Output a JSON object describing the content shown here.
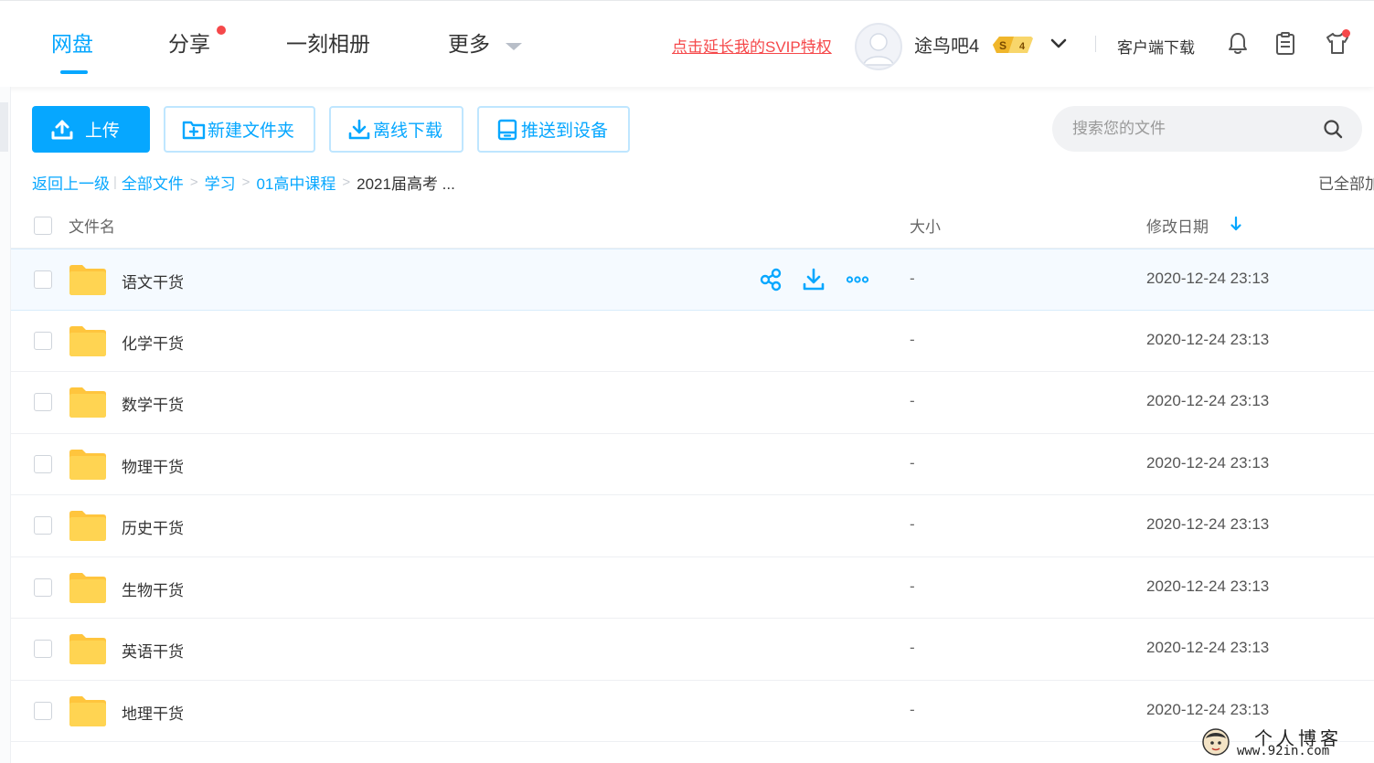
{
  "nav": {
    "tabs": [
      {
        "label": "网盘",
        "active": true
      },
      {
        "label": "分享",
        "has_dot": true
      },
      {
        "label": "一刻相册"
      },
      {
        "label": "更多",
        "has_caret": true
      }
    ],
    "svip_link": "点击延长我的SVIP特权",
    "username": "途鸟吧4",
    "vip_level": "4",
    "client_download": "客户端下载",
    "icons": [
      "bell-icon",
      "clipboard-icon",
      "tshirt-icon"
    ]
  },
  "toolbar": {
    "upload": "上传",
    "new_folder": "新建文件夹",
    "offline_download": "离线下载",
    "push_device": "推送到设备",
    "search_placeholder": "搜索您的文件"
  },
  "breadcrumb": {
    "back": "返回上一级",
    "items": [
      "全部文件",
      "学习",
      "01高中课程"
    ],
    "current": "2021届高考 ...",
    "loaded_status": "已全部加载"
  },
  "table": {
    "headers": {
      "name": "文件名",
      "size": "大小",
      "date": "修改日期"
    },
    "rows": [
      {
        "name": "语文干货",
        "size": "-",
        "date": "2020-12-24 23:13"
      },
      {
        "name": "化学干货",
        "size": "-",
        "date": "2020-12-24 23:13"
      },
      {
        "name": "数学干货",
        "size": "-",
        "date": "2020-12-24 23:13"
      },
      {
        "name": "物理干货",
        "size": "-",
        "date": "2020-12-24 23:13"
      },
      {
        "name": "历史干货",
        "size": "-",
        "date": "2020-12-24 23:13"
      },
      {
        "name": "生物干货",
        "size": "-",
        "date": "2020-12-24 23:13"
      },
      {
        "name": "英语干货",
        "size": "-",
        "date": "2020-12-24 23:13"
      },
      {
        "name": "地理干货",
        "size": "-",
        "date": "2020-12-24 23:13"
      }
    ]
  },
  "watermark": {
    "title": "个人博客",
    "url": "www.92in.com"
  },
  "colors": {
    "accent": "#06a7ff",
    "alert": "#f5484a",
    "folder": "#ffd452"
  }
}
